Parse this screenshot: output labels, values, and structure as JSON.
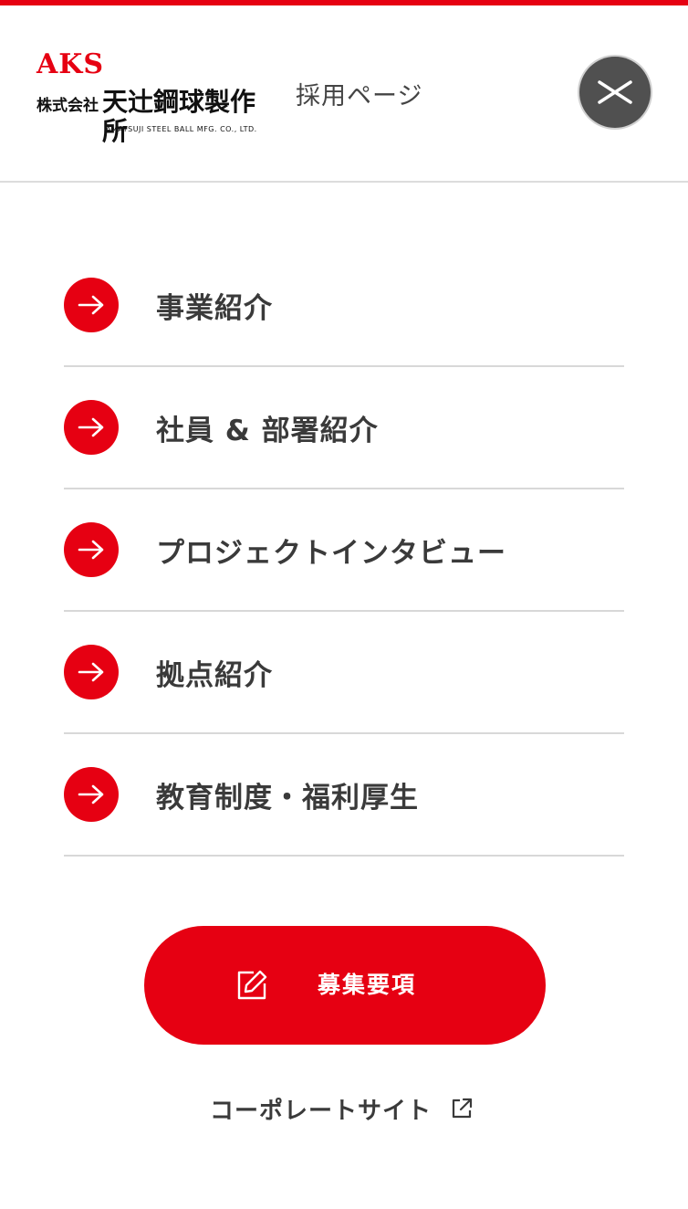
{
  "brand": {
    "aks": "AKS",
    "company_prefix": "株式会社",
    "company_name": "天辻鋼球製作所",
    "company_en": "AMATSUJI STEEL BALL MFG. CO., LTD.",
    "recruit_label": "採用ページ",
    "accent_color": "#e60012"
  },
  "header": {
    "close_icon": "close-icon"
  },
  "menu": {
    "items": [
      {
        "label": "事業紹介",
        "icon": "arrow-right-icon"
      },
      {
        "label": "社員 & 部署紹介",
        "icon": "arrow-right-icon"
      },
      {
        "label": "プロジェクトインタビュー",
        "icon": "arrow-right-icon"
      },
      {
        "label": "拠点紹介",
        "icon": "arrow-right-icon"
      },
      {
        "label": "教育制度・福利厚生",
        "icon": "arrow-right-icon"
      }
    ]
  },
  "apply": {
    "label": "募集要項",
    "icon": "edit-icon"
  },
  "corporate": {
    "label": "コーポレートサイト",
    "icon": "external-link-icon"
  }
}
